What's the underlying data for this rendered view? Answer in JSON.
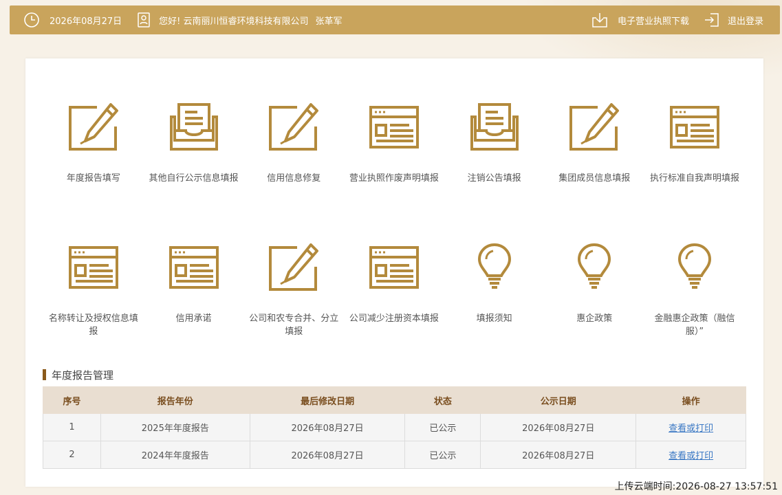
{
  "header": {
    "date": "2026年08月27日",
    "greeting": "您好! 云南丽川恒睿环境科技有限公司",
    "user_name": "张革军",
    "license_download": "电子营业执照下载",
    "logout": "退出登录",
    "icons": [
      "clock-icon",
      "user-card-icon",
      "download-icon",
      "logout-icon"
    ]
  },
  "colors": {
    "brand_gold": "#c9a45c",
    "icon_gold": "#b38a3c",
    "table_header_bg": "#e9ded1",
    "link_blue": "#3a78c4"
  },
  "menu": [
    {
      "label": "年度报告填写",
      "icon": "edit-icon"
    },
    {
      "label": "其他自行公示信息填报",
      "icon": "inbox-document-icon"
    },
    {
      "label": "信用信息修复",
      "icon": "edit-icon"
    },
    {
      "label": "营业执照作废声明填报",
      "icon": "browser-form-icon"
    },
    {
      "label": "注销公告填报",
      "icon": "inbox-document-icon"
    },
    {
      "label": "集团成员信息填报",
      "icon": "edit-icon"
    },
    {
      "label": "执行标准自我声明填报",
      "icon": "browser-form-icon"
    },
    {
      "label": "名称转让及授权信息填报",
      "icon": "browser-form-icon"
    },
    {
      "label": "信用承诺",
      "icon": "browser-form-icon"
    },
    {
      "label": "公司和农专合并、分立填报",
      "icon": "edit-icon"
    },
    {
      "label": "公司减少注册资本填报",
      "icon": "browser-form-icon"
    },
    {
      "label": "填报须知",
      "icon": "lightbulb-icon"
    },
    {
      "label": "惠企政策",
      "icon": "lightbulb-icon"
    },
    {
      "label": "金融惠企政策（融信服）”",
      "icon": "lightbulb-icon"
    }
  ],
  "report_section": {
    "title": "年度报告管理",
    "columns": [
      "序号",
      "报告年份",
      "最后修改日期",
      "状态",
      "公示日期",
      "操作"
    ],
    "rows": [
      {
        "no": "1",
        "year": "2025年年度报告",
        "modified": "2026年08月27日",
        "status": "已公示",
        "published": "2026年08月27日",
        "action": "查看或打印"
      },
      {
        "no": "2",
        "year": "2024年年度报告",
        "modified": "2026年08月27日",
        "status": "已公示",
        "published": "2026年08月27日",
        "action": "查看或打印"
      }
    ]
  },
  "footer": {
    "upload_time": "上传云端时间:2026-08-27 13:57:51"
  }
}
